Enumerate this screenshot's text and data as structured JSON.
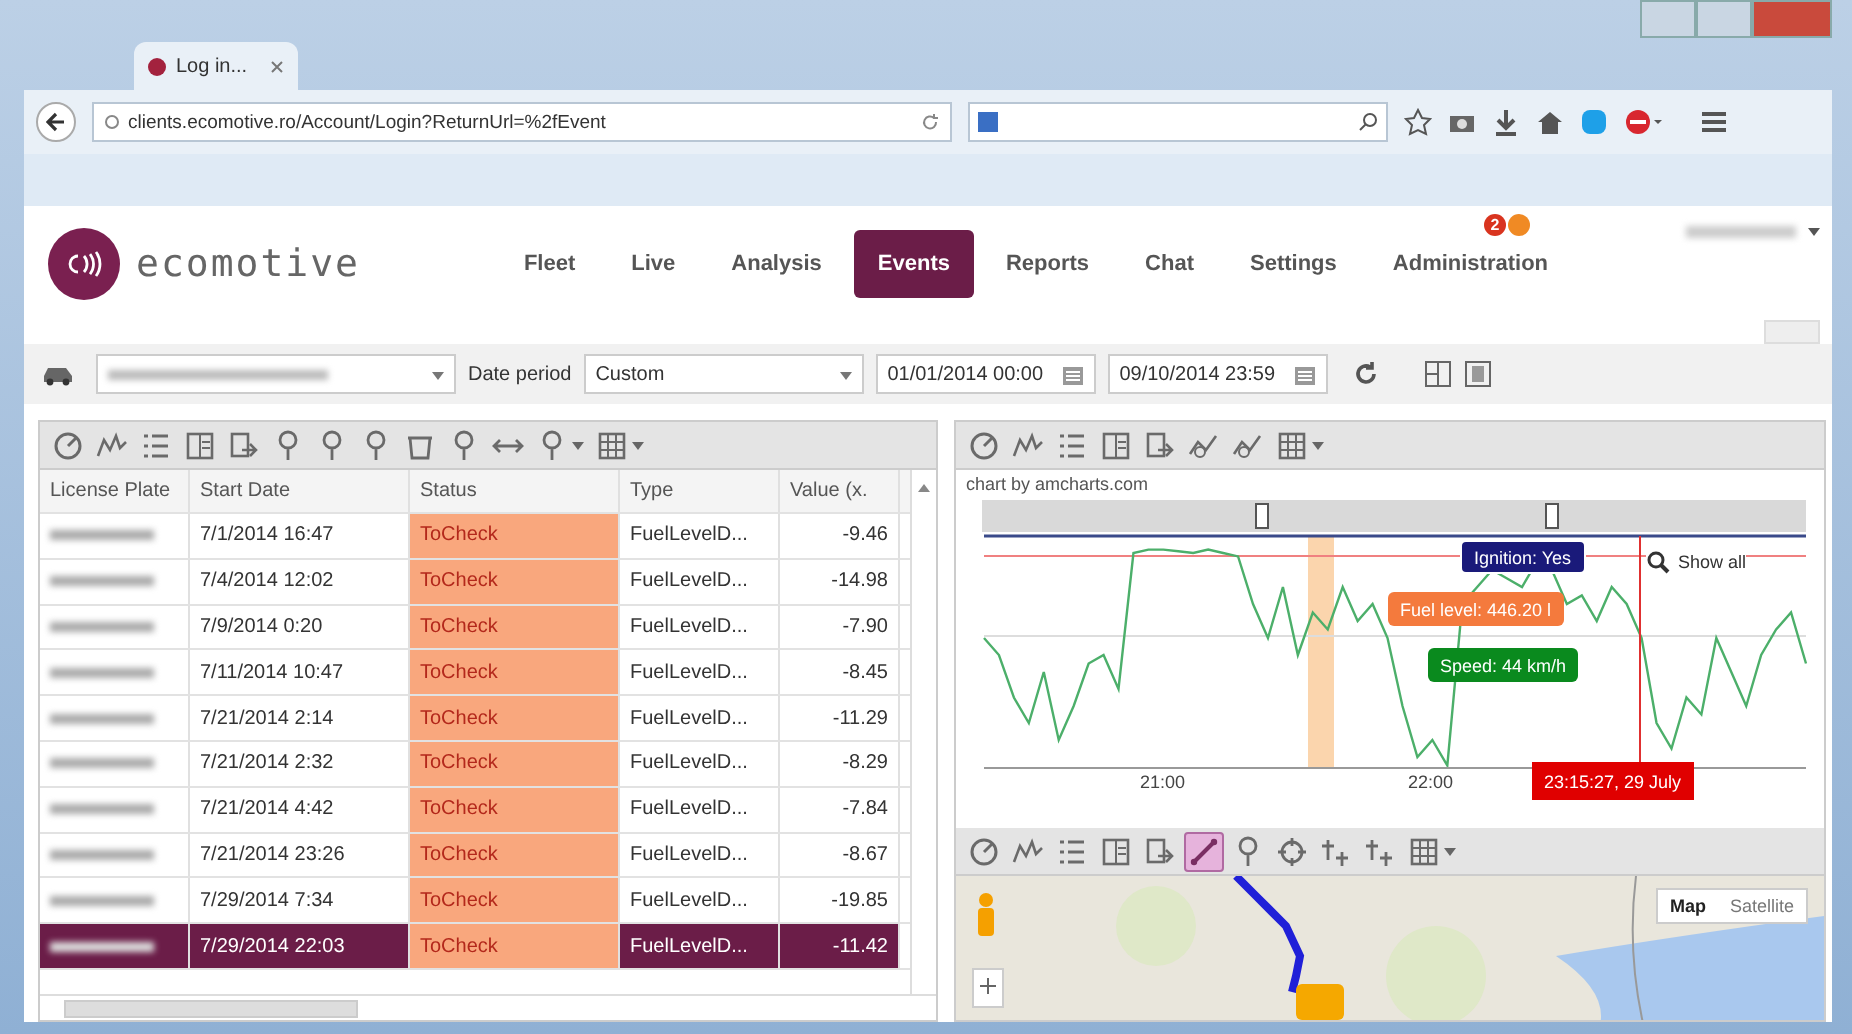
{
  "browser": {
    "tab_title": "Log in...",
    "url": "clients.ecomotive.ro/Account/Login?ReturnUrl=%2fEvent"
  },
  "app": {
    "logo_text": "ecomotive",
    "nav": [
      {
        "label": "Fleet",
        "selected": false
      },
      {
        "label": "Live",
        "selected": false
      },
      {
        "label": "Analysis",
        "selected": false
      },
      {
        "label": "Events",
        "selected": true
      },
      {
        "label": "Reports",
        "selected": false
      },
      {
        "label": "Chat",
        "selected": false
      },
      {
        "label": "Settings",
        "selected": false
      },
      {
        "label": "Administration",
        "selected": false
      }
    ],
    "badges": [
      {
        "count": "2",
        "color": "#d9341f"
      },
      {
        "color": "#f08a24"
      }
    ]
  },
  "filters": {
    "date_period_label": "Date period",
    "date_period": "Custom",
    "date_from": "01/01/2014 00:00",
    "date_to": "09/10/2014 23:59"
  },
  "events": {
    "columns": [
      "License Plate",
      "Start Date",
      "Status",
      "Type",
      "Value (x."
    ],
    "rows": [
      {
        "start_date": "7/1/2014 16:47",
        "status": "ToCheck",
        "type": "FuelLevelD...",
        "value": "-9.46",
        "selected": false
      },
      {
        "start_date": "7/4/2014 12:02",
        "status": "ToCheck",
        "type": "FuelLevelD...",
        "value": "-14.98",
        "selected": false
      },
      {
        "start_date": "7/9/2014 0:20",
        "status": "ToCheck",
        "type": "FuelLevelD...",
        "value": "-7.90",
        "selected": false
      },
      {
        "start_date": "7/11/2014 10:47",
        "status": "ToCheck",
        "type": "FuelLevelD...",
        "value": "-8.45",
        "selected": false
      },
      {
        "start_date": "7/21/2014 2:14",
        "status": "ToCheck",
        "type": "FuelLevelD...",
        "value": "-11.29",
        "selected": false
      },
      {
        "start_date": "7/21/2014 2:32",
        "status": "ToCheck",
        "type": "FuelLevelD...",
        "value": "-8.29",
        "selected": false
      },
      {
        "start_date": "7/21/2014 4:42",
        "status": "ToCheck",
        "type": "FuelLevelD...",
        "value": "-7.84",
        "selected": false
      },
      {
        "start_date": "7/21/2014 23:26",
        "status": "ToCheck",
        "type": "FuelLevelD...",
        "value": "-8.67",
        "selected": false
      },
      {
        "start_date": "7/29/2014 7:34",
        "status": "ToCheck",
        "type": "FuelLevelD...",
        "value": "-19.85",
        "selected": false
      },
      {
        "start_date": "7/29/2014 22:03",
        "status": "ToCheck",
        "type": "FuelLevelD...",
        "value": "-11.42",
        "selected": true
      }
    ]
  },
  "chart": {
    "credit": "chart by amcharts.com",
    "x_labels": [
      "21:00",
      "22:00"
    ],
    "show_all": "Show all",
    "balloons": [
      {
        "kind": "ignition",
        "text": "Ignition: Yes"
      },
      {
        "kind": "fuel",
        "text": "Fuel level: 446.20 l"
      },
      {
        "kind": "speed",
        "text": "Speed: 44 km/h"
      }
    ],
    "cursor_label": "23:15:27, 29 July"
  },
  "map": {
    "toolbar": [
      {
        "selected": false
      },
      {
        "selected": false
      },
      {
        "selected": false
      },
      {
        "selected": false
      },
      {
        "selected": false
      },
      {
        "selected": true
      },
      {
        "selected": false
      },
      {
        "selected": false
      },
      {
        "selected": false
      },
      {
        "selected": false
      },
      {
        "selected": false
      }
    ],
    "types": [
      {
        "label": "Map",
        "selected": true
      },
      {
        "label": "Satellite",
        "selected": false
      }
    ]
  }
}
